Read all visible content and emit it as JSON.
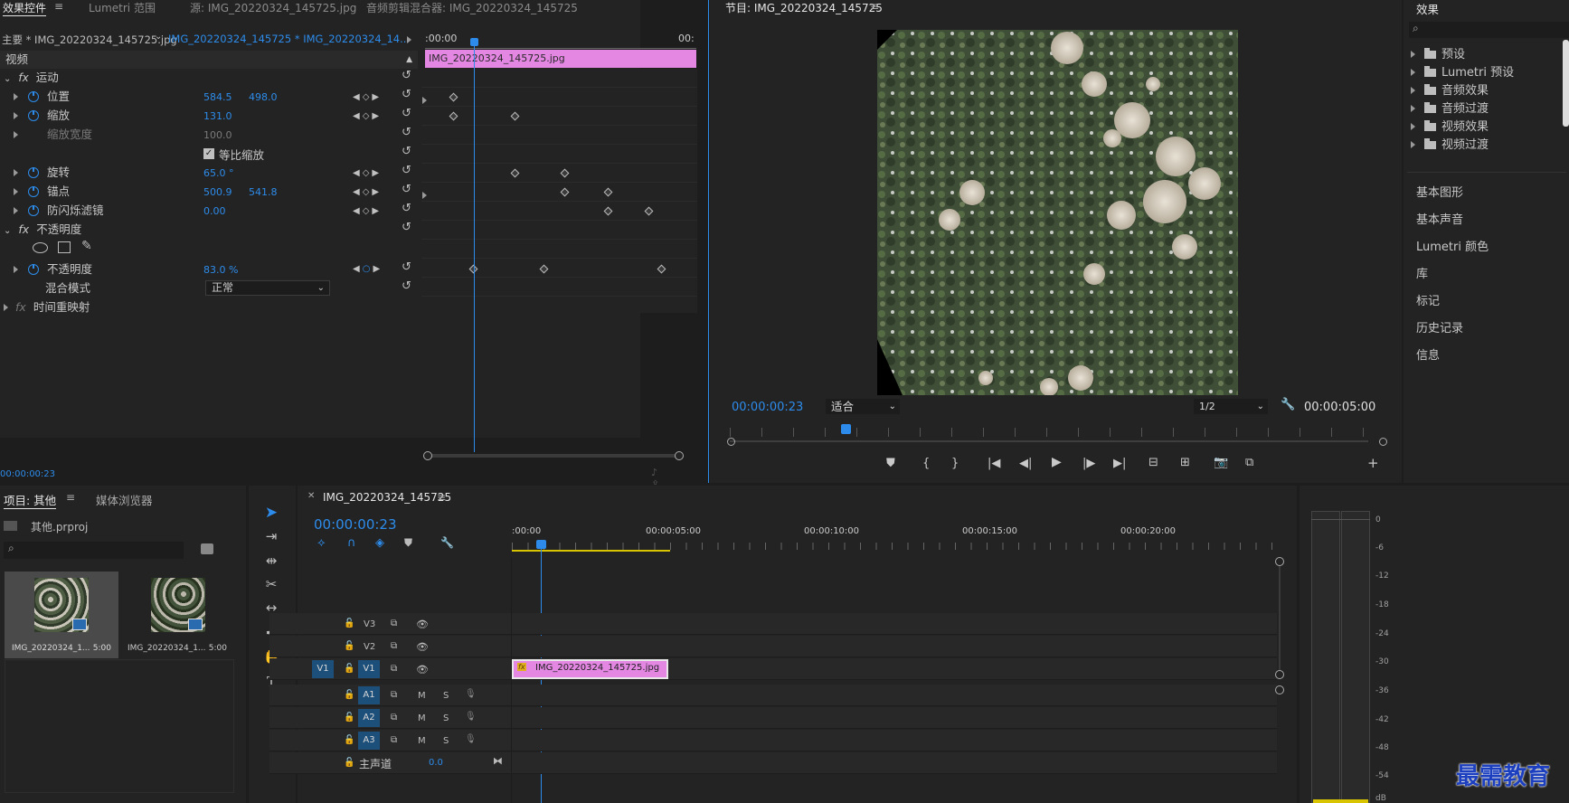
{
  "effect_controls": {
    "tabs": [
      "效果控件",
      "Lumetri 范围",
      "源: IMG_20220324_145725.jpg",
      "音频剪辑混合器: IMG_20220324_145725"
    ],
    "menu_icon": "menu-icon",
    "master_label": "主要 * IMG_20220324_145725.jpg",
    "seq_label": "IMG_20220324_145725 * IMG_20220324_14...",
    "time_start": ":00:00",
    "time_end": "00:",
    "clip_name": "IMG_20220324_145725.jpg",
    "section_video": "视频",
    "motion": "运动",
    "position_label": "位置",
    "position_x": "584.5",
    "position_y": "498.0",
    "scale_label": "缩放",
    "scale_value": "131.0",
    "scale_width_label": "缩放宽度",
    "scale_width_value": "100.0",
    "uniform_scale_label": "等比缩放",
    "rotation_label": "旋转",
    "rotation_value": "65.0 °",
    "anchor_label": "锚点",
    "anchor_x": "500.9",
    "anchor_y": "541.8",
    "antiflicker_label": "防闪烁滤镜",
    "antiflicker_value": "0.00",
    "opacity_section": "不透明度",
    "opacity_label": "不透明度",
    "opacity_value": "83.0 %",
    "blend_label": "混合模式",
    "blend_value": "正常",
    "time_remap": "时间重映射",
    "current_time": "00:00:00:23"
  },
  "program": {
    "title": "节目: IMG_20220324_145725",
    "timecode": "00:00:00:23",
    "fit": "适合",
    "resolution": "1/2",
    "duration": "00:00:05:00"
  },
  "effects": {
    "title": "效果",
    "search_placeholder": "",
    "folders": [
      "预设",
      "Lumetri 预设",
      "音频效果",
      "音频过渡",
      "视频效果",
      "视频过渡"
    ],
    "panels": [
      "基本图形",
      "基本声音",
      "Lumetri 颜色",
      "库",
      "标记",
      "历史记录",
      "信息"
    ]
  },
  "project": {
    "tab_project": "项目: 其他",
    "tab_media": "媒体浏览器",
    "file": "其他.prproj",
    "items": [
      {
        "name": "IMG_20220324_1...",
        "duration": "5:00"
      },
      {
        "name": "IMG_20220324_1...",
        "duration": "5:00"
      }
    ]
  },
  "timeline": {
    "tab": "IMG_20220324_145725",
    "timecode": "00:00:00:23",
    "ruler": [
      ":00:00",
      "00:00:05:00",
      "00:00:10:00",
      "00:00:15:00",
      "00:00:20:00"
    ],
    "tracks_video": [
      "V3",
      "V2",
      "V1"
    ],
    "tracks_audio": [
      "A1",
      "A2",
      "A3"
    ],
    "source_patch_v": "V1",
    "mute": "M",
    "solo": "S",
    "master": "主声道",
    "master_value": "0.0",
    "clip": "IMG_20220324_145725.jpg",
    "fx": "fx"
  },
  "meter": {
    "db": [
      "0",
      "-6",
      "-12",
      "-18",
      "-24",
      "-30",
      "-36",
      "-42",
      "-48",
      "-54",
      "dB"
    ]
  },
  "watermark": "最需教育",
  "colors": {
    "accent": "#2d8ceb",
    "clip": "#e487e3",
    "bg": "#232323"
  }
}
